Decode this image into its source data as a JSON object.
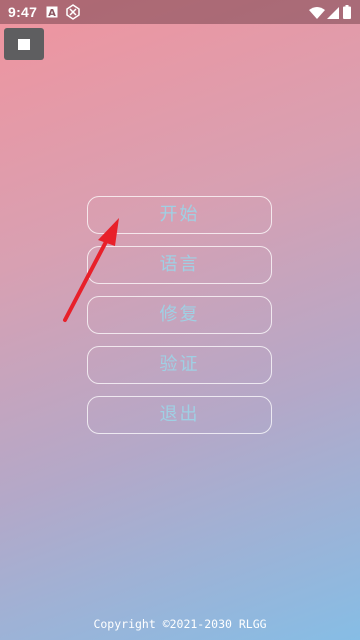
{
  "statusbar": {
    "time": "9:47",
    "icons": [
      "a-notification-icon",
      "app-notification-icon",
      "wifi-icon",
      "signal-icon",
      "battery-icon"
    ]
  },
  "stop_button": {
    "icon": "stop-icon"
  },
  "menu": {
    "start": "开始",
    "language": "语言",
    "repair": "修复",
    "verify": "验证",
    "exit": "退出"
  },
  "annotation": {
    "icon": "red-arrow-icon",
    "color": "#e8202a"
  },
  "footer": {
    "copyright": "Copyright ©2021-2030 RLGG"
  },
  "colors": {
    "gradient_top": "#f0949e",
    "gradient_bottom": "#86bde5",
    "button_text": "#9fd0e4"
  }
}
